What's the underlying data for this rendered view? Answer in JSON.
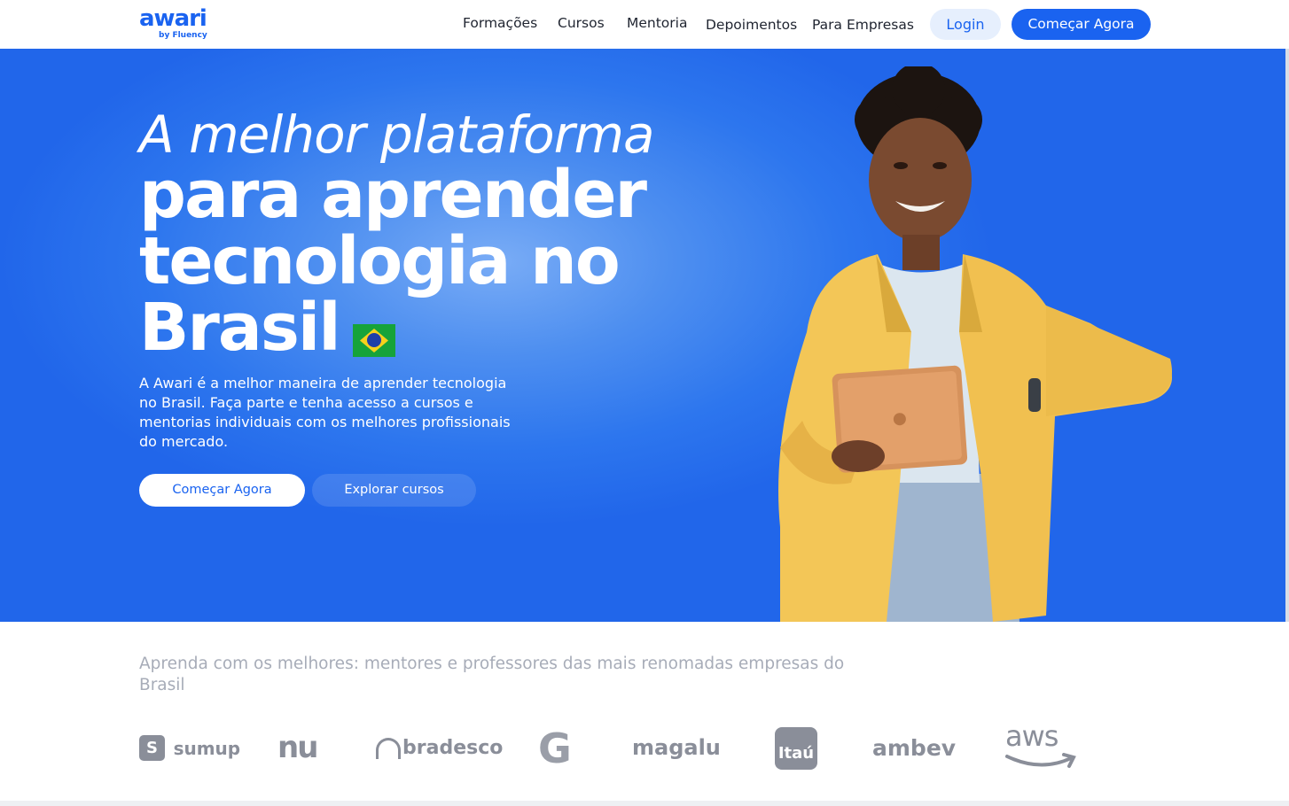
{
  "header": {
    "logo_main": "awari",
    "logo_sub": "by Fluency",
    "nav": [
      "Formações",
      "Cursos",
      "Mentoria",
      "Depoimentos",
      "Para Empresas"
    ],
    "login_label": "Login",
    "cta_label": "Começar Agora"
  },
  "hero": {
    "title_light": "A melhor plataforma",
    "title_bold_1": "para aprender",
    "title_bold_2": "tecnologia no",
    "title_bold_3": "Brasil",
    "description": "A Awari é a melhor maneira de aprender tecnologia no Brasil. Faça parte e tenha acesso a cursos e mentorias individuais com os melhores profissionais do mercado.",
    "primary_label": "Começar Agora",
    "secondary_label": "Explorar cursos"
  },
  "partners": {
    "title": "Aprenda com os melhores: mentores e professores das mais renomadas empresas do Brasil",
    "logos": {
      "sumup": "sumup",
      "nubank": "nu",
      "bradesco": "bradesco",
      "google": "G",
      "magalu": "magalu",
      "itau": "Itaú",
      "ambev": "ambev",
      "aws": "aws"
    }
  },
  "colors": {
    "brand": "#1a63f0",
    "hero_blue": "#2d76ee",
    "logo_gray": "#8a8e99"
  }
}
